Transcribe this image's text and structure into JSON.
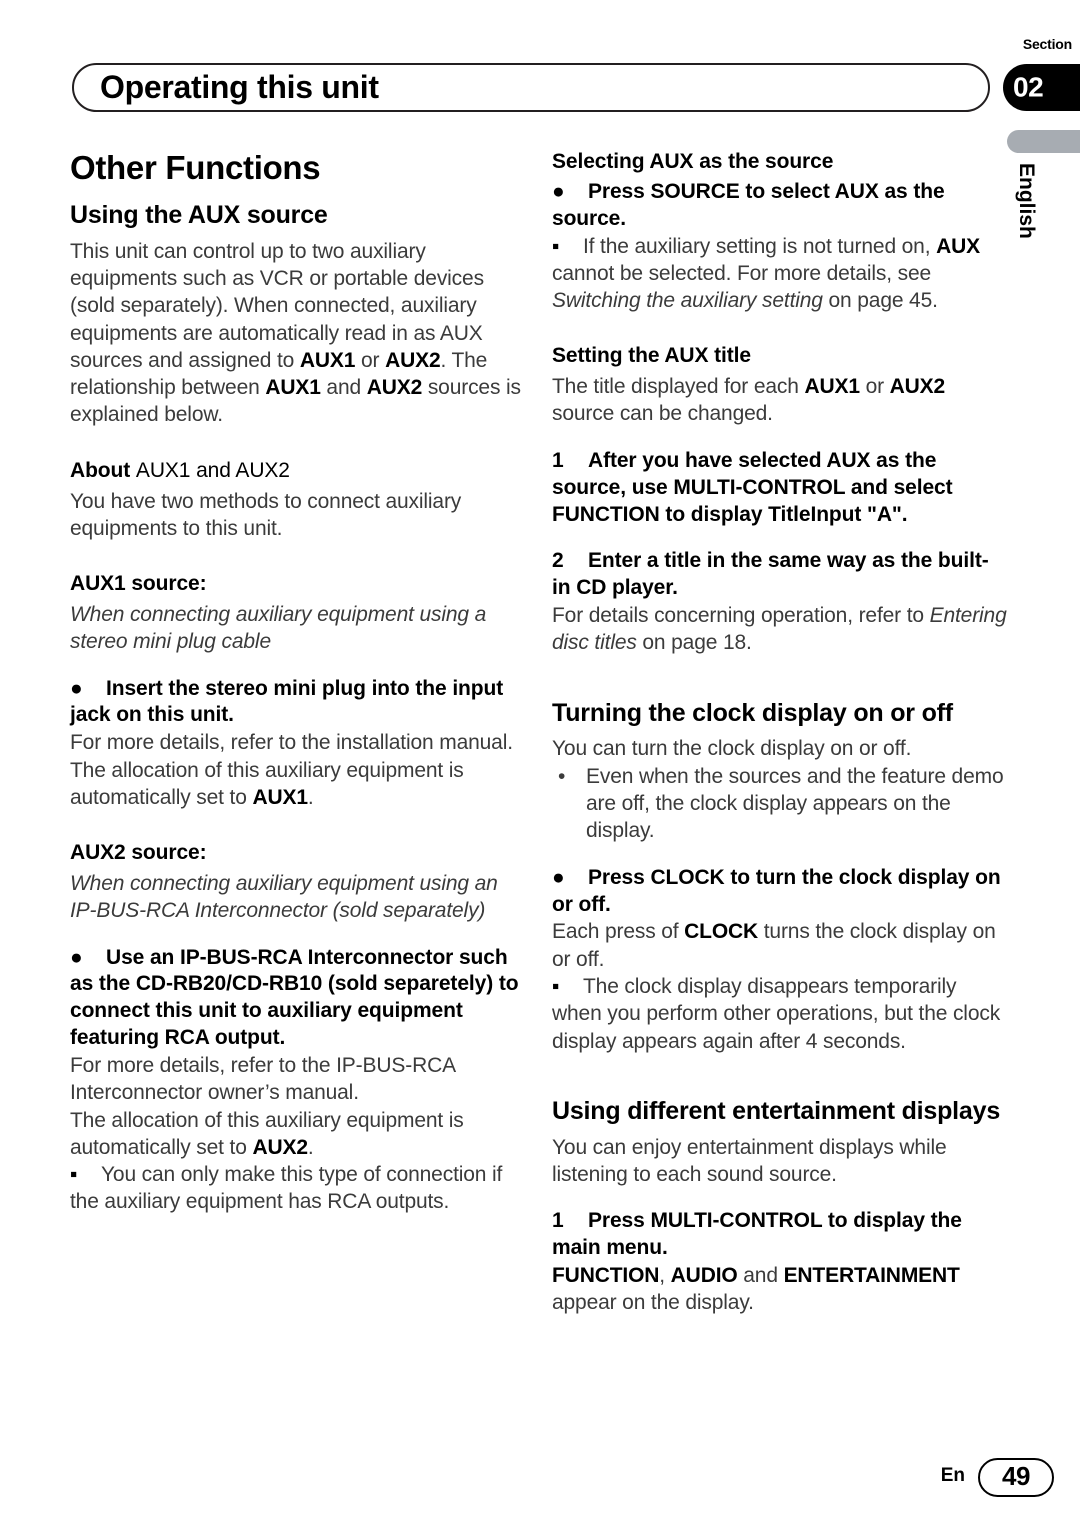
{
  "header": {
    "running_title": "Operating this unit",
    "section_word": "Section",
    "section_number": "02",
    "language_tab": "English"
  },
  "footer": {
    "lang_code": "En",
    "page_number": "49"
  },
  "left_column": {
    "chapter_title": "Other Functions",
    "heading_using_aux": "Using the AUX source",
    "intro_p1_a": "This unit can control up to two auxiliary equipments such as VCR or portable devices (sold separately). When connected, auxiliary equipments are automatically read in as AUX sources and assigned to ",
    "intro_aux1": "AUX1",
    "intro_or": " or ",
    "intro_aux2": "AUX2",
    "intro_p1_b": ". The relationship between ",
    "intro_aux1b": "AUX1",
    "intro_and": " and ",
    "intro_aux2b": "AUX2",
    "intro_p1_c": " sources is explained below.",
    "about_bold": "About",
    "about_light": "AUX1 and AUX2",
    "about_body": "You have two methods to connect auxiliary equipments to this unit.",
    "aux1_source_heading": "AUX1 source:",
    "aux1_source_italic": "When connecting auxiliary equipment using a stereo mini plug cable",
    "aux1_instruction": "Insert the stereo mini plug into the input jack on this unit.",
    "aux1_detail_1": "For more details, refer to the installation manual.",
    "aux1_detail_2a": "The allocation of this auxiliary equipment is automatically set to ",
    "aux1_detail_2b": "AUX1",
    "aux1_detail_2c": ".",
    "aux2_source_heading": "AUX2 source:",
    "aux2_source_italic": "When connecting auxiliary equipment using an IP-BUS-RCA Interconnector (sold separately)",
    "aux2_instruction": "Use an IP-BUS-RCA Interconnector such as the CD-RB20/CD-RB10 (sold separetely) to connect this unit to auxiliary equipment featuring RCA output.",
    "aux2_detail_1": "For more details, refer to the IP-BUS-RCA Interconnector owner’s manual.",
    "aux2_detail_2a": "The allocation of this auxiliary equipment is automatically set to ",
    "aux2_detail_2b": "AUX2",
    "aux2_detail_2c": ".",
    "aux2_note": "You can only make this type of connection if the auxiliary equipment has RCA outputs.",
    "bullet_dot": "●",
    "bullet_square": "▪"
  },
  "right_column": {
    "heading_selecting_aux": "Selecting AUX as the source",
    "selecting_instruction": "Press SOURCE to select AUX as the source.",
    "selecting_note_a": "If the auxiliary setting is not turned on, ",
    "selecting_note_aux": "AUX",
    "selecting_note_b": " cannot be selected. For more details, see ",
    "selecting_note_italic": "Switching the auxiliary setting",
    "selecting_note_c": " on page 45.",
    "heading_setting_title": "Setting the AUX title",
    "setting_body_a": "The title displayed for each ",
    "setting_body_aux1": "AUX1",
    "setting_body_or": " or ",
    "setting_body_aux2": "AUX2",
    "setting_body_b": " source can be changed.",
    "step1_num": "1",
    "step1_text": "After you have selected AUX as the source, use MULTI-CONTROL and select FUNCTION to display TitleInput \"A\".",
    "step2_num": "2",
    "step2_text": "Enter a title in the same way as the built-in CD player.",
    "step2_detail_a": "For details concerning operation, refer to ",
    "step2_detail_italic": "Entering disc titles",
    "step2_detail_b": " on page 18.",
    "heading_clock": "Turning the clock display on or off",
    "clock_body": "You can turn the clock display on or off.",
    "clock_dot_item": "Even when the sources and the feature demo are off, the clock display appears on the display.",
    "clock_instruction": "Press CLOCK to turn the clock display on or off.",
    "clock_detail_a": "Each press of ",
    "clock_detail_clock": "CLOCK",
    "clock_detail_b": " turns the clock display on or off.",
    "clock_note": "The clock display disappears temporarily when you perform other operations, but the clock display appears again after 4 seconds.",
    "heading_entertainment": "Using different entertainment displays",
    "entertainment_body": "You can enjoy entertainment displays while listening to each sound source.",
    "ent_step1_num": "1",
    "ent_step1_text": "Press MULTI-CONTROL to display the main menu.",
    "ent_detail_function": "FUNCTION",
    "ent_detail_comma": ", ",
    "ent_detail_audio": "AUDIO",
    "ent_detail_and": " and ",
    "ent_detail_entertainment": "ENTERTAINMENT",
    "ent_detail_rest": " appear on the display.",
    "bullet_dot": "●",
    "bullet_square": "▪",
    "bullet_small_dot": "•"
  },
  "colors": {
    "tab_black": "#000000",
    "tab_grey": "#a7acb2",
    "body_text": "#3b3b3b"
  }
}
